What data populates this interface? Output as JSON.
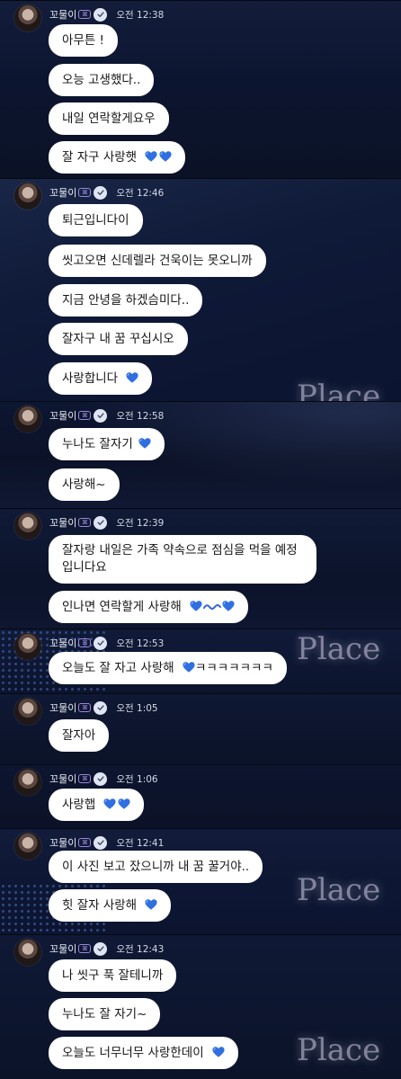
{
  "sender": {
    "name": "꼬물이",
    "band_glyph": "ꕤ",
    "verified_icon": "verified-check-icon",
    "avatar_icon": "profile-avatar"
  },
  "watermark_text": "Place",
  "colors": {
    "bubble_bg": "#ffffff",
    "heart": "#2f6fe0",
    "wave": "#3a66d0",
    "background": "#0b1428"
  },
  "blocks": [
    {
      "time": "오전 12:38",
      "messages": [
        "아무튼 !",
        "오능 고생했다..",
        "내일 연락할게요우",
        "잘 자구 사랑햇"
      ]
    },
    {
      "time": "오전 12:46",
      "messages": [
        "퇴근입니다이",
        "씻고오면 신데렐라 건욱이는 못오니까",
        "지금 안녕을 하겠슴미다..",
        "잘자구 내 꿈 꾸십시오",
        "사랑합니다"
      ]
    },
    {
      "time": "오전 12:58",
      "messages": [
        "누나도 잘자기",
        "사랑해~"
      ]
    },
    {
      "time": "오전 12:39",
      "messages": [
        "잘자랑 내일은 가족 약속으로 점심을 먹을 예정입니다요",
        "인나면 연락할게 사랑해"
      ]
    },
    {
      "time": "오전 12:53",
      "messages": [
        "오늘도 잘 자고 사랑해",
        "ㅋㅋㅋㅋㅋㅋㅋ"
      ]
    },
    {
      "time": "오전 1:05",
      "messages": [
        "잘자아"
      ]
    },
    {
      "time": "오전 1:06",
      "messages": [
        "사랑햅"
      ]
    },
    {
      "time": "오전 12:41",
      "messages": [
        "이 사진 보고 잤으니까 내 꿈 꿀거야..",
        "힛 잘자 사랑해"
      ]
    },
    {
      "time": "오전 12:43",
      "messages": [
        "나 씻구 푹 잘테니까",
        "누나도 잘 자기~",
        "오늘도 너무너무 사랑한데이"
      ]
    }
  ]
}
